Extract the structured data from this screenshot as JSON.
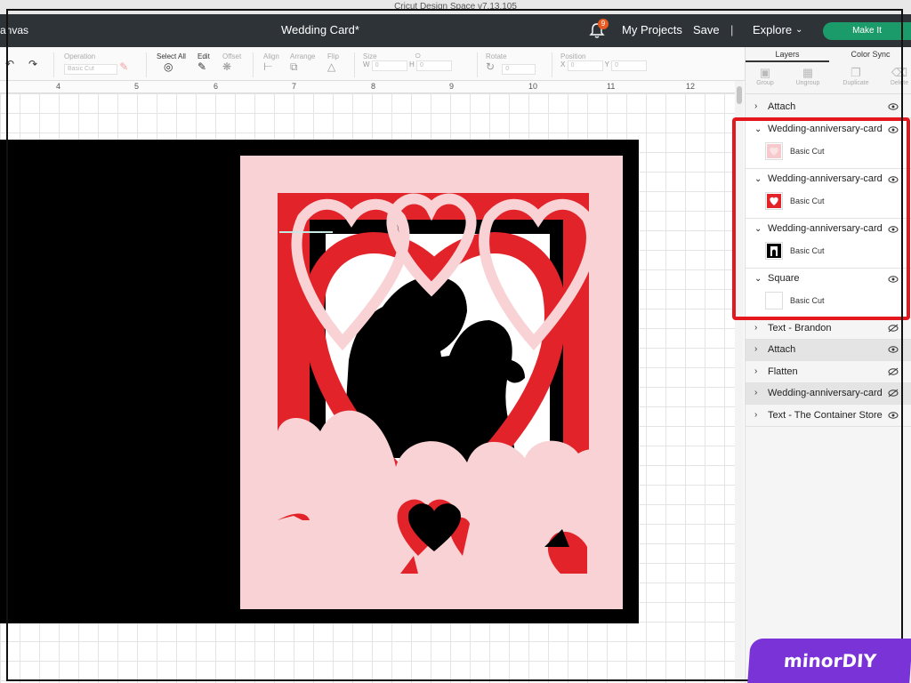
{
  "window": {
    "title": "Cricut Design Space  v7.13.105"
  },
  "header": {
    "canvas_label": "anvas",
    "doc_title": "Wedding Card*",
    "notifications": "9",
    "my_projects": "My Projects",
    "save": "Save",
    "separator": "|",
    "explore": "Explore",
    "make_it": "Make It"
  },
  "toolbar": {
    "operation_label": "Operation",
    "operation_value": "Basic Cut",
    "select_all": "Select All",
    "edit": "Edit",
    "offset": "Offset",
    "align": "Align",
    "arrange": "Arrange",
    "flip": "Flip",
    "size": "Size",
    "w": "W",
    "h": "H",
    "w_value": "0",
    "h_value": "0",
    "rotate": "Rotate",
    "rotate_value": "0",
    "position": "Position",
    "x": "X",
    "y": "Y",
    "x_value": "0",
    "y_value": "0"
  },
  "ruler": {
    "marks": [
      "4",
      "5",
      "6",
      "7",
      "8",
      "9",
      "10",
      "11",
      "12"
    ]
  },
  "panel": {
    "tabs": [
      "Layers",
      "Color Sync"
    ],
    "tools": [
      "Group",
      "Ungroup",
      "Duplicate",
      "Delete"
    ],
    "layers": [
      {
        "name": "Attach",
        "arrow": "›",
        "expanded": false
      },
      {
        "name": "Wedding-anniversary-card",
        "arrow": "⌄",
        "expanded": true,
        "child": "Basic Cut",
        "thumb_color": "#f6c9cc"
      },
      {
        "name": "Wedding-anniversary-card",
        "arrow": "⌄",
        "expanded": true,
        "child": "Basic Cut",
        "thumb_color": "#e2232a"
      },
      {
        "name": "Wedding-anniversary-card",
        "arrow": "⌄",
        "expanded": true,
        "child": "Basic Cut",
        "thumb_color": "#000000"
      },
      {
        "name": "Square",
        "arrow": "⌄",
        "expanded": true,
        "child": "Basic Cut",
        "thumb_color": "#ffffff"
      },
      {
        "name": "Text - Brandon",
        "arrow": "›",
        "hidden": true
      },
      {
        "name": "Attach",
        "arrow": "›",
        "grey": true
      },
      {
        "name": "Flatten",
        "arrow": "›",
        "hidden": true
      },
      {
        "name": "Wedding-anniversary-card",
        "arrow": "›",
        "hidden": true,
        "grey": true
      },
      {
        "name": "Text - The Container Store",
        "arrow": "›"
      }
    ]
  },
  "colors": {
    "card_pink": "#f8d2d4",
    "heart_red": "#e2232a",
    "highlight": "#e4161e",
    "make_it": "#1c9b6a"
  },
  "watermark": "minorDIY"
}
